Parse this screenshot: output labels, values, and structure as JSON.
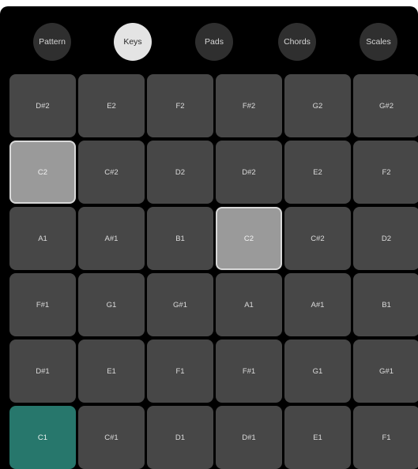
{
  "modes": [
    {
      "label": "Pattern",
      "active": false
    },
    {
      "label": "Keys",
      "active": true
    },
    {
      "label": "Pads",
      "active": false
    },
    {
      "label": "Chords",
      "active": false
    },
    {
      "label": "Scales",
      "active": false
    }
  ],
  "pads": [
    [
      {
        "note": "D#2"
      },
      {
        "note": "E2"
      },
      {
        "note": "F2"
      },
      {
        "note": "F#2"
      },
      {
        "note": "G2"
      },
      {
        "note": "G#2"
      }
    ],
    [
      {
        "note": "C2",
        "state": "highlight"
      },
      {
        "note": "C#2"
      },
      {
        "note": "D2"
      },
      {
        "note": "D#2"
      },
      {
        "note": "E2"
      },
      {
        "note": "F2"
      }
    ],
    [
      {
        "note": "A1"
      },
      {
        "note": "A#1"
      },
      {
        "note": "B1"
      },
      {
        "note": "C2",
        "state": "highlight"
      },
      {
        "note": "C#2"
      },
      {
        "note": "D2"
      }
    ],
    [
      {
        "note": "F#1"
      },
      {
        "note": "G1"
      },
      {
        "note": "G#1"
      },
      {
        "note": "A1"
      },
      {
        "note": "A#1"
      },
      {
        "note": "B1"
      }
    ],
    [
      {
        "note": "D#1"
      },
      {
        "note": "E1"
      },
      {
        "note": "F1"
      },
      {
        "note": "F#1"
      },
      {
        "note": "G1"
      },
      {
        "note": "G#1"
      }
    ],
    [
      {
        "note": "C1",
        "state": "root"
      },
      {
        "note": "C#1"
      },
      {
        "note": "D1"
      },
      {
        "note": "D#1"
      },
      {
        "note": "E1"
      },
      {
        "note": "F1"
      }
    ]
  ],
  "colors": {
    "background": "#000000",
    "pad": "#474747",
    "pad_highlight": "#9a9a9a",
    "pad_root": "#27776c",
    "mode_button": "#2f2f2f",
    "mode_button_active": "#e4e4e4"
  }
}
